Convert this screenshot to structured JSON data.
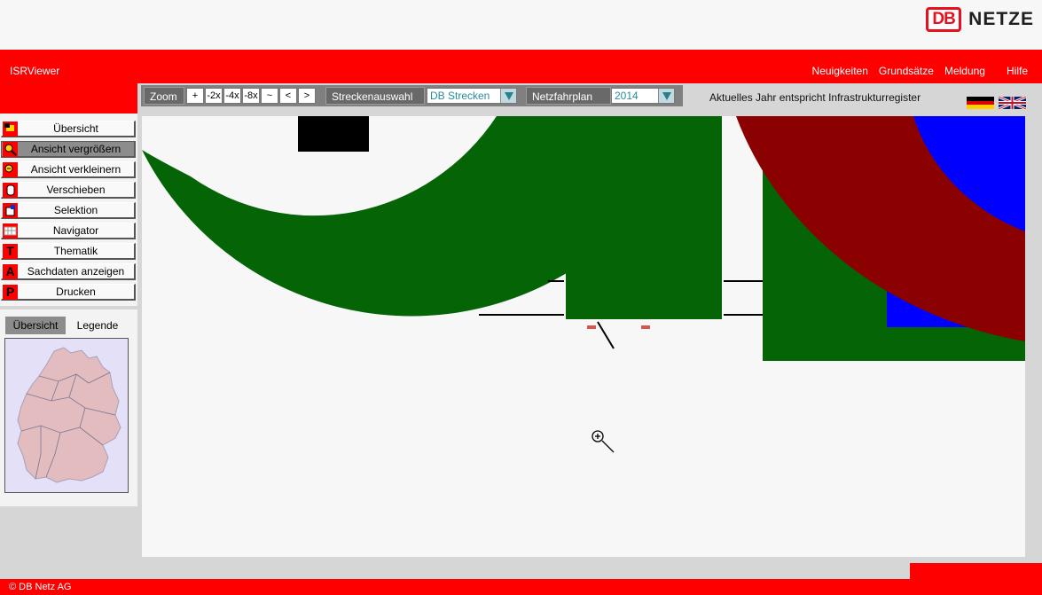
{
  "brand": {
    "logo_db": "DB",
    "logo_netze": "NETZE",
    "accent": "#ff0000"
  },
  "app": {
    "title": "ISRViewer"
  },
  "nav": [
    "Neuigkeiten",
    "Grundsätze",
    "Meldung",
    "Hilfe"
  ],
  "toolbar": {
    "zoom_label": "Zoom",
    "zoom_buttons": [
      "+",
      "-2x",
      "-4x",
      "-8x",
      "~",
      "<",
      ">"
    ],
    "route_label": "Streckenauswahl",
    "route_value": "DB Strecken",
    "plan_label": "Netzfahrplan",
    "plan_value": "2014"
  },
  "status": "Aktuelles Jahr entspricht Infrastrukturregister",
  "languages": [
    {
      "name": "de-flag-icon"
    },
    {
      "name": "uk-flag-icon"
    }
  ],
  "menu": [
    {
      "label": "Übersicht",
      "icon": "overview-icon"
    },
    {
      "label": "Ansicht vergrößern",
      "icon": "zoom-in-icon",
      "active": true
    },
    {
      "label": "Ansicht verkleinern",
      "icon": "zoom-out-icon"
    },
    {
      "label": "Verschieben",
      "icon": "hand-icon"
    },
    {
      "label": "Selektion",
      "icon": "select-icon"
    },
    {
      "label": "Navigator",
      "icon": "navigator-icon"
    },
    {
      "label": "Thematik",
      "icon": "T"
    },
    {
      "label": "Sachdaten anzeigen",
      "icon": "A"
    },
    {
      "label": "Drucken",
      "icon": "P"
    }
  ],
  "overview_tabs": [
    "Übersicht",
    "Legende"
  ],
  "map_colors": {
    "green": "#056405",
    "darkred": "#8b0000",
    "blue": "#0000ff",
    "black": "#000000"
  },
  "footer": {
    "copyright": "© DB Netz AG"
  }
}
